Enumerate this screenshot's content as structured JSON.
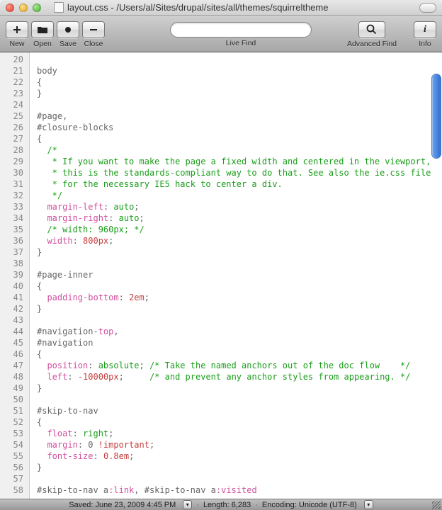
{
  "window": {
    "title": "layout.css - /Users/al/Sites/drupal/sites/all/themes/squirreltheme"
  },
  "toolbar": {
    "new_label": "New",
    "open_label": "Open",
    "save_label": "Save",
    "close_label": "Close",
    "live_find_label": "Live Find",
    "advanced_find_label": "Advanced Find",
    "info_label": "Info",
    "search_value": ""
  },
  "editor": {
    "first_line": 20,
    "lines": [
      {
        "n": 20,
        "segs": []
      },
      {
        "n": 21,
        "segs": [
          {
            "t": "body",
            "c": "s-selector"
          }
        ]
      },
      {
        "n": 22,
        "segs": [
          {
            "t": "{",
            "c": "s-brace"
          }
        ]
      },
      {
        "n": 23,
        "segs": [
          {
            "t": "}",
            "c": "s-brace"
          }
        ]
      },
      {
        "n": 24,
        "segs": []
      },
      {
        "n": 25,
        "segs": [
          {
            "t": "#page",
            "c": "s-selector"
          },
          {
            "t": ",",
            "c": "s-num"
          }
        ]
      },
      {
        "n": 26,
        "segs": [
          {
            "t": "#closure-blocks",
            "c": "s-selector"
          }
        ]
      },
      {
        "n": 27,
        "segs": [
          {
            "t": "{",
            "c": "s-brace"
          }
        ]
      },
      {
        "n": 28,
        "segs": [
          {
            "t": "  /*",
            "c": "s-comment"
          }
        ]
      },
      {
        "n": 29,
        "segs": [
          {
            "t": "   * If you want to make the page a fixed width and centered in the viewport,",
            "c": "s-comment"
          }
        ]
      },
      {
        "n": 30,
        "segs": [
          {
            "t": "   * this is the standards-compliant way to do that. See also the ie.css file",
            "c": "s-comment"
          }
        ]
      },
      {
        "n": 31,
        "segs": [
          {
            "t": "   * for the necessary IE5 hack to center a div.",
            "c": "s-comment"
          }
        ]
      },
      {
        "n": 32,
        "segs": [
          {
            "t": "   */",
            "c": "s-comment"
          }
        ]
      },
      {
        "n": 33,
        "segs": [
          {
            "t": "  ",
            "c": ""
          },
          {
            "t": "margin-left",
            "c": "s-prop"
          },
          {
            "t": ": ",
            "c": "s-num"
          },
          {
            "t": "auto",
            "c": "s-value"
          },
          {
            "t": ";",
            "c": "s-num"
          }
        ]
      },
      {
        "n": 34,
        "segs": [
          {
            "t": "  ",
            "c": ""
          },
          {
            "t": "margin-right",
            "c": "s-prop"
          },
          {
            "t": ": ",
            "c": "s-num"
          },
          {
            "t": "auto",
            "c": "s-value"
          },
          {
            "t": ";",
            "c": "s-num"
          }
        ]
      },
      {
        "n": 35,
        "segs": [
          {
            "t": "  ",
            "c": ""
          },
          {
            "t": "/* width: 960px; */",
            "c": "s-comment"
          }
        ]
      },
      {
        "n": 36,
        "segs": [
          {
            "t": "  ",
            "c": ""
          },
          {
            "t": "width",
            "c": "s-prop"
          },
          {
            "t": ": ",
            "c": "s-num"
          },
          {
            "t": "800px",
            "c": "s-special"
          },
          {
            "t": ";",
            "c": "s-num"
          }
        ]
      },
      {
        "n": 37,
        "segs": [
          {
            "t": "}",
            "c": "s-brace"
          }
        ]
      },
      {
        "n": 38,
        "segs": []
      },
      {
        "n": 39,
        "segs": [
          {
            "t": "#page-inner",
            "c": "s-selector"
          }
        ]
      },
      {
        "n": 40,
        "segs": [
          {
            "t": "{",
            "c": "s-brace"
          }
        ]
      },
      {
        "n": 41,
        "segs": [
          {
            "t": "  ",
            "c": ""
          },
          {
            "t": "padding-bottom",
            "c": "s-prop"
          },
          {
            "t": ": ",
            "c": "s-num"
          },
          {
            "t": "2em",
            "c": "s-special"
          },
          {
            "t": ";",
            "c": "s-num"
          }
        ]
      },
      {
        "n": 42,
        "segs": [
          {
            "t": "}",
            "c": "s-brace"
          }
        ]
      },
      {
        "n": 43,
        "segs": []
      },
      {
        "n": 44,
        "segs": [
          {
            "t": "#navigation-",
            "c": "s-selector"
          },
          {
            "t": "top",
            "c": "s-prop"
          },
          {
            "t": ",",
            "c": "s-num"
          }
        ]
      },
      {
        "n": 45,
        "segs": [
          {
            "t": "#navigation",
            "c": "s-selector"
          }
        ]
      },
      {
        "n": 46,
        "segs": [
          {
            "t": "{",
            "c": "s-brace"
          }
        ]
      },
      {
        "n": 47,
        "segs": [
          {
            "t": "  ",
            "c": ""
          },
          {
            "t": "position",
            "c": "s-prop"
          },
          {
            "t": ": ",
            "c": "s-num"
          },
          {
            "t": "absolute",
            "c": "s-value"
          },
          {
            "t": "; ",
            "c": "s-num"
          },
          {
            "t": "/* Take the named anchors out of the doc flow    */",
            "c": "s-comment"
          }
        ]
      },
      {
        "n": 48,
        "segs": [
          {
            "t": "  ",
            "c": ""
          },
          {
            "t": "left",
            "c": "s-prop"
          },
          {
            "t": ": ",
            "c": "s-num"
          },
          {
            "t": "-10000px",
            "c": "s-special"
          },
          {
            "t": ";     ",
            "c": "s-num"
          },
          {
            "t": "/* and prevent any anchor styles from appearing. */",
            "c": "s-comment"
          }
        ]
      },
      {
        "n": 49,
        "segs": [
          {
            "t": "}",
            "c": "s-brace"
          }
        ]
      },
      {
        "n": 50,
        "segs": []
      },
      {
        "n": 51,
        "segs": [
          {
            "t": "#skip-to-nav",
            "c": "s-selector"
          }
        ]
      },
      {
        "n": 52,
        "segs": [
          {
            "t": "{",
            "c": "s-brace"
          }
        ]
      },
      {
        "n": 53,
        "segs": [
          {
            "t": "  ",
            "c": ""
          },
          {
            "t": "float",
            "c": "s-prop"
          },
          {
            "t": ": ",
            "c": "s-num"
          },
          {
            "t": "right",
            "c": "s-value"
          },
          {
            "t": ";",
            "c": "s-num"
          }
        ]
      },
      {
        "n": 54,
        "segs": [
          {
            "t": "  ",
            "c": ""
          },
          {
            "t": "margin",
            "c": "s-prop"
          },
          {
            "t": ": ",
            "c": "s-num"
          },
          {
            "t": "0 ",
            "c": "s-num"
          },
          {
            "t": "!important",
            "c": "s-special"
          },
          {
            "t": ";",
            "c": "s-num"
          }
        ]
      },
      {
        "n": 55,
        "segs": [
          {
            "t": "  ",
            "c": ""
          },
          {
            "t": "font-size",
            "c": "s-prop"
          },
          {
            "t": ": ",
            "c": "s-num"
          },
          {
            "t": "0.8em",
            "c": "s-special"
          },
          {
            "t": ";",
            "c": "s-num"
          }
        ]
      },
      {
        "n": 56,
        "segs": [
          {
            "t": "}",
            "c": "s-brace"
          }
        ]
      },
      {
        "n": 57,
        "segs": []
      },
      {
        "n": 58,
        "segs": [
          {
            "t": "#skip-to-nav a",
            "c": "s-selector"
          },
          {
            "t": ":link",
            "c": "s-pseudo"
          },
          {
            "t": ", #skip-to-nav a",
            "c": "s-selector"
          },
          {
            "t": ":visited",
            "c": "s-pseudo"
          }
        ]
      }
    ]
  },
  "status": {
    "saved": "Saved: June 23, 2009 4:45 PM",
    "length": "Length: 6,283",
    "encoding": "Encoding: Unicode (UTF-8)",
    "sep": "·"
  }
}
